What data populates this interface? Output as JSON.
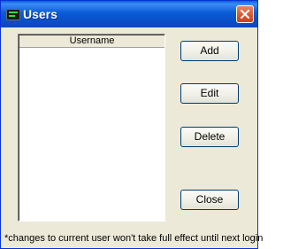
{
  "window": {
    "title": "Users",
    "icon": "terminal-icon",
    "close_icon": "close-icon"
  },
  "user_list": {
    "column_header": "Username",
    "rows": []
  },
  "buttons": {
    "add": "Add",
    "edit": "Edit",
    "delete": "Delete",
    "close": "Close"
  },
  "footnote": "*changes to current user won't take full effect until next login"
}
